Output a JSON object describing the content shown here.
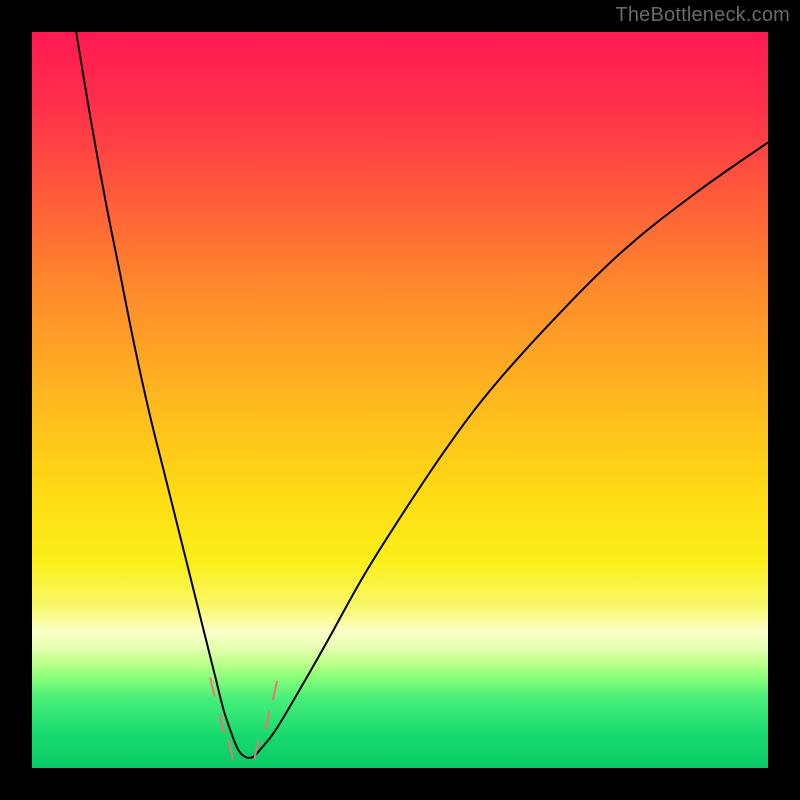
{
  "watermark": "TheBottleneck.com",
  "chart_data": {
    "type": "line",
    "title": "",
    "xlabel": "",
    "ylabel": "",
    "xlim": [
      0,
      100
    ],
    "ylim": [
      0,
      100
    ],
    "grid": false,
    "legend": false,
    "gradient_stops": [
      {
        "offset": 0.0,
        "color": "#ff1a52"
      },
      {
        "offset": 0.1,
        "color": "#ff2f4b"
      },
      {
        "offset": 0.22,
        "color": "#ff5a3b"
      },
      {
        "offset": 0.35,
        "color": "#ff8a2c"
      },
      {
        "offset": 0.5,
        "color": "#ffb81f"
      },
      {
        "offset": 0.62,
        "color": "#ffd915"
      },
      {
        "offset": 0.72,
        "color": "#fbef1a"
      },
      {
        "offset": 0.78,
        "color": "#f9f86a"
      },
      {
        "offset": 0.815,
        "color": "#fbffc8"
      },
      {
        "offset": 0.835,
        "color": "#e8ffb3"
      },
      {
        "offset": 0.855,
        "color": "#c3ff8f"
      },
      {
        "offset": 0.875,
        "color": "#8fff7a"
      },
      {
        "offset": 0.905,
        "color": "#48ef79"
      },
      {
        "offset": 0.955,
        "color": "#18db6e"
      },
      {
        "offset": 1.0,
        "color": "#08c964"
      }
    ],
    "series": [
      {
        "name": "bottleneck-curve",
        "x": [
          6,
          8,
          10,
          12,
          14,
          16,
          18,
          20,
          22,
          24,
          25,
          26,
          27,
          28,
          29,
          30,
          31,
          33,
          36,
          40,
          45,
          50,
          56,
          62,
          70,
          80,
          90,
          100
        ],
        "y": [
          100,
          88,
          77,
          67,
          57,
          48,
          40,
          32,
          24,
          16,
          12,
          8,
          5,
          2.5,
          1.5,
          1.5,
          2.5,
          5,
          10,
          17,
          26,
          34,
          43,
          51,
          60,
          70,
          78,
          85
        ]
      }
    ],
    "markers": [
      {
        "x": 24.5,
        "y": 11
      },
      {
        "x": 25.8,
        "y": 6
      },
      {
        "x": 27.0,
        "y": 2.5
      },
      {
        "x": 30.5,
        "y": 2.5
      },
      {
        "x": 32.0,
        "y": 6.5
      },
      {
        "x": 33.0,
        "y": 10.5
      }
    ]
  }
}
